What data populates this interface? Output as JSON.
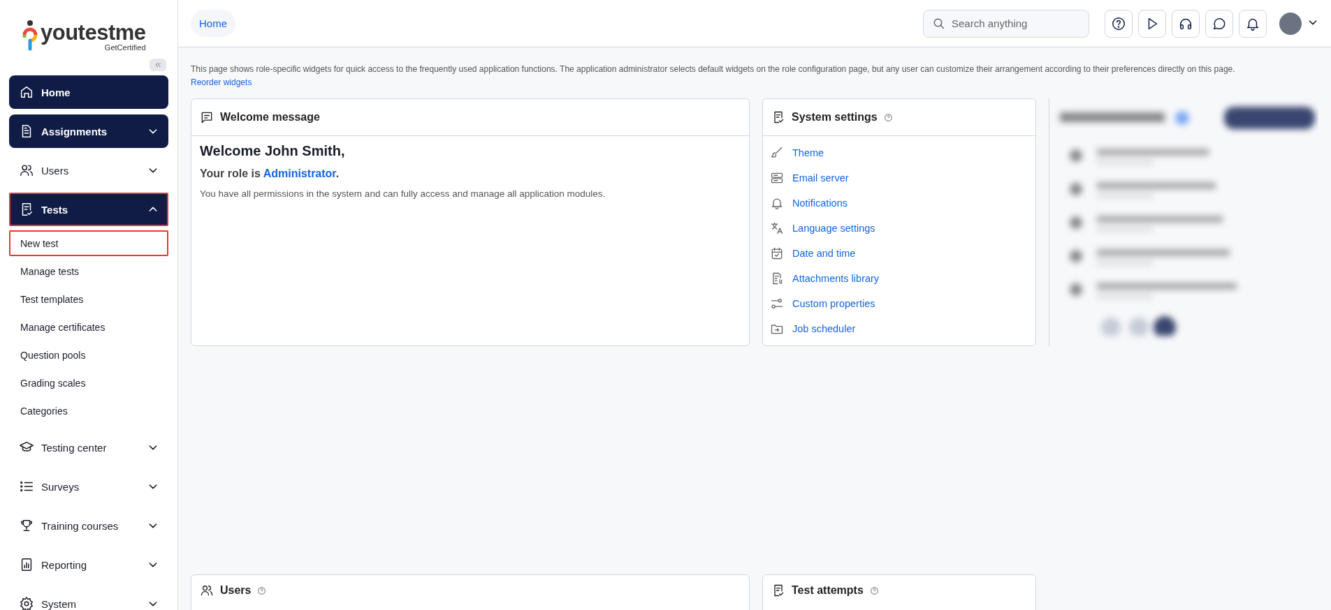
{
  "logo": {
    "name": "youtestme",
    "tagline": "GetCertified"
  },
  "sidebar": {
    "items": [
      {
        "label": "Home",
        "active": true,
        "highlighted": false
      },
      {
        "label": "Assignments",
        "active": true,
        "expanded": false,
        "highlighted": false
      },
      {
        "label": "Users",
        "active": false,
        "expanded": false,
        "highlighted": false
      },
      {
        "label": "Tests",
        "active": true,
        "expanded": true,
        "highlighted": true,
        "children": [
          {
            "label": "New test",
            "highlighted": true
          },
          {
            "label": "Manage tests",
            "highlighted": false
          },
          {
            "label": "Test templates",
            "highlighted": false
          },
          {
            "label": "Manage certificates",
            "highlighted": false
          },
          {
            "label": "Question pools",
            "highlighted": false
          },
          {
            "label": "Grading scales",
            "highlighted": false
          },
          {
            "label": "Categories",
            "highlighted": false
          }
        ]
      },
      {
        "label": "Testing center",
        "active": false,
        "expanded": false,
        "highlighted": false
      },
      {
        "label": "Surveys",
        "active": false,
        "expanded": false,
        "highlighted": false
      },
      {
        "label": "Training courses",
        "active": false,
        "expanded": false,
        "highlighted": false
      },
      {
        "label": "Reporting",
        "active": false,
        "expanded": false,
        "highlighted": false
      },
      {
        "label": "System",
        "active": false,
        "expanded": false,
        "highlighted": false
      }
    ]
  },
  "header": {
    "breadcrumb": "Home",
    "search": {
      "placeholder": "Search anything"
    }
  },
  "intro": {
    "text": "This page shows role-specific widgets for quick access to the frequently used application functions. The application administrator selects default widgets on the role configuration page, but any user can customize their arrangement according to their preferences directly on this page.",
    "link": "Reorder widgets"
  },
  "welcome_card": {
    "title": "Welcome message",
    "greeting": "Welcome John Smith,",
    "role_before": "Your role is",
    "role": "Administrator",
    "role_after": ".",
    "description": "You have all permissions in the system and can fully access and manage all application modules."
  },
  "settings_card": {
    "title": "System settings",
    "links": [
      "Theme",
      "Email server",
      "Notifications",
      "Language settings",
      "Date and time",
      "Attachments library",
      "Custom properties",
      "Job scheduler"
    ]
  },
  "bottom_cards": [
    {
      "title": "Users"
    },
    {
      "title": "Test attempts"
    }
  ]
}
